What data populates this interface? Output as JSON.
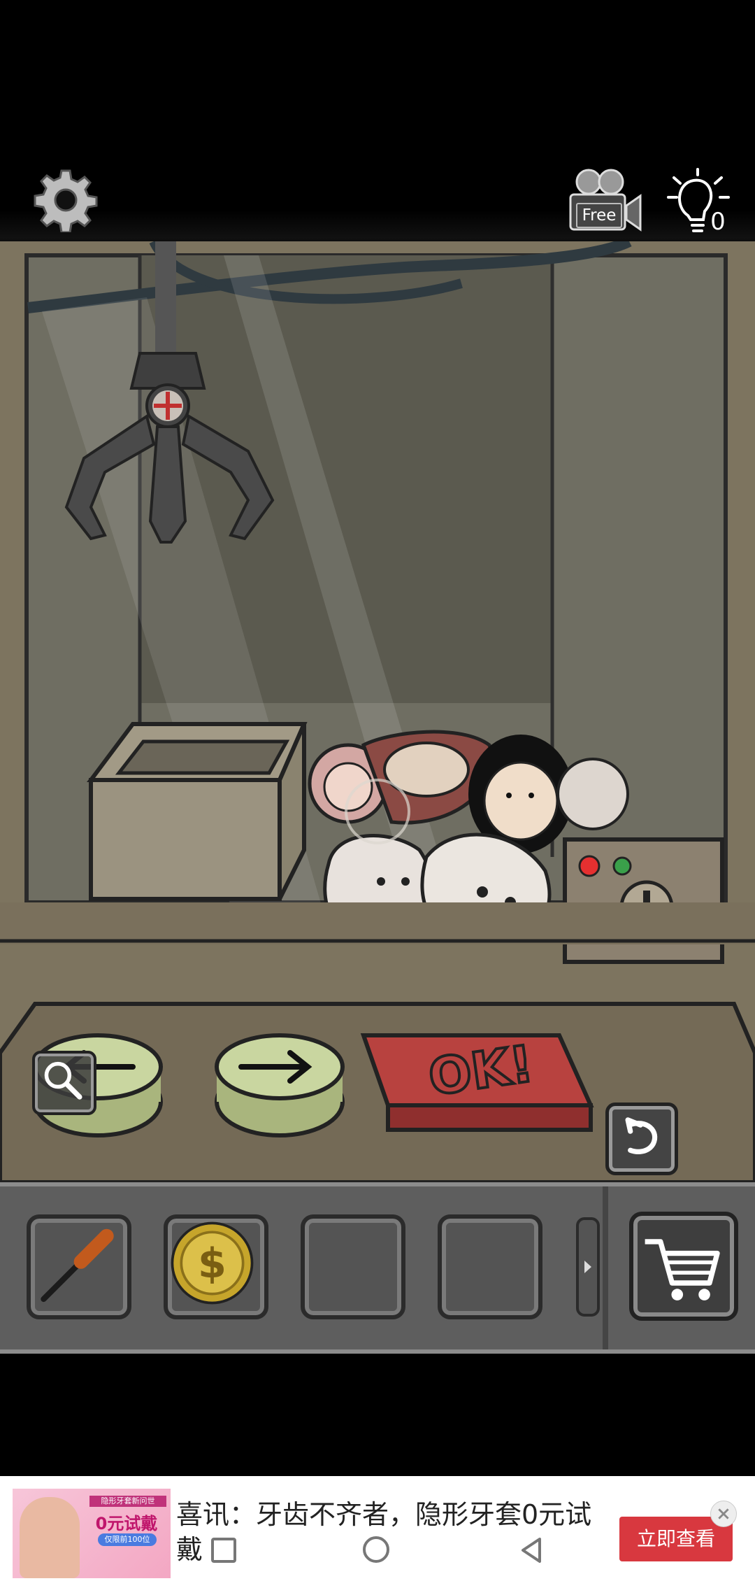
{
  "hud": {
    "settings_icon": "gear-icon",
    "video_hint_label": "Free",
    "video_icon": "video-camera-icon",
    "hint_icon": "lightbulb-icon",
    "hint_count": "0"
  },
  "scene": {
    "left_button_icon": "arrow-left-icon",
    "right_button_icon": "arrow-right-icon",
    "ok_button_label": "OK!",
    "zoom_icon": "magnifier-icon",
    "undo_icon": "undo-icon",
    "coin_slot_lights": [
      "#e53030",
      "#3aa04a"
    ]
  },
  "inventory": {
    "slots": [
      {
        "item": "screwdriver-icon"
      },
      {
        "item": "coin-icon"
      },
      {
        "item": ""
      },
      {
        "item": ""
      }
    ],
    "next_icon": "chevron-right-icon",
    "shop_icon": "shopping-cart-icon"
  },
  "ad": {
    "image_badge": "隐形牙套新问世",
    "image_title": "0元试戴",
    "image_pill": "仅限前100位",
    "text": "喜讯：牙齿不齐者，隐形牙套0元试戴",
    "cta": "立即查看",
    "close_icon": "close-icon"
  },
  "colors": {
    "wall": "#8d846f",
    "counter": "#6b604d",
    "button_green": "#c9d6a0",
    "ok_red": "#b8423f"
  }
}
